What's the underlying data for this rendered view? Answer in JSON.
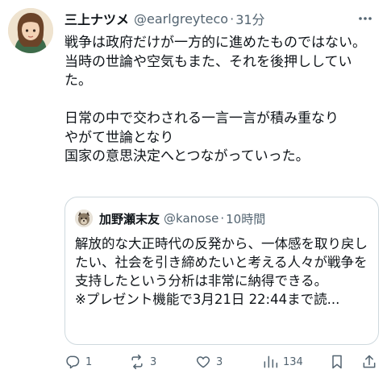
{
  "author": {
    "display_name": "三上ナツメ",
    "handle": "@earlgreyteco",
    "separator": "·",
    "time": "31分"
  },
  "body": {
    "text": "戦争は政府だけが一方的に進めたものではない。\n当時の世論や空気もまた、それを後押ししていた。\n\n日常の中で交わされる一言一言が積み重なり\nやがて世論となり\n国家の意思決定へとつながっていった。"
  },
  "quote": {
    "display_name": "加野瀬末友",
    "handle": "@kanose",
    "separator": "·",
    "time": "10時間",
    "text": "解放的な大正時代の反発から、一体感を取り戻したい、社会を引き締めたいと考える人々が戦争を支持したという分析は非常に納得できる。\n※プレゼント機能で3月21日 22:44まで読..."
  },
  "actions": {
    "reply_count": "1",
    "repost_count": "3",
    "like_count": "3",
    "view_count": "134"
  },
  "icons": {
    "more": "more-horizontal-icon",
    "reply": "reply-icon",
    "repost": "repost-icon",
    "like": "heart-icon",
    "views": "views-icon",
    "bookmark": "bookmark-icon",
    "share": "share-icon"
  },
  "colors": {
    "text": "#0f1419",
    "secondary": "#536471",
    "border": "#cfd9de"
  }
}
